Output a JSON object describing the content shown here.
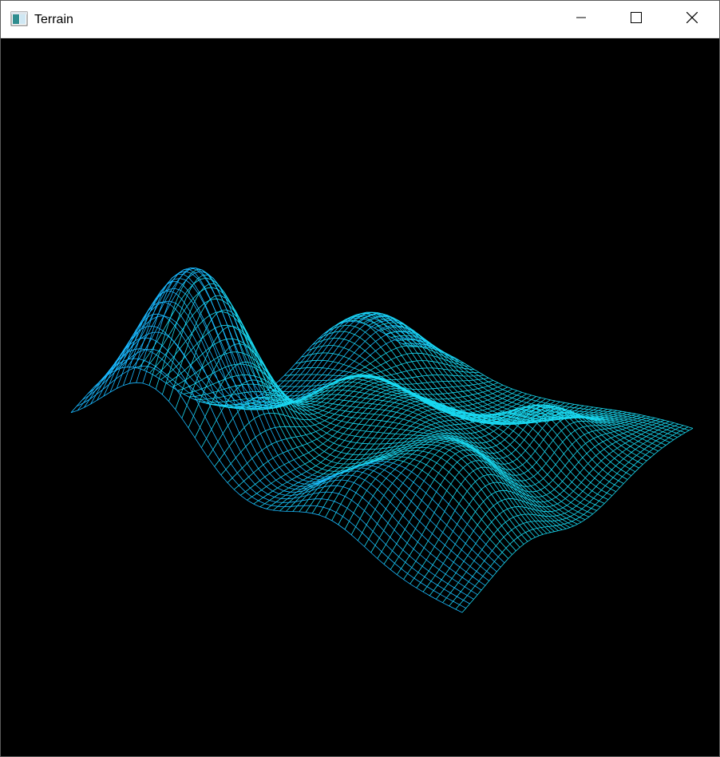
{
  "window": {
    "title": "Terrain",
    "icon": "window-app-icon",
    "controls": [
      {
        "name": "minimize",
        "icon": "minimize-icon"
      },
      {
        "name": "maximize",
        "icon": "maximize-icon"
      },
      {
        "name": "close",
        "icon": "close-icon"
      }
    ]
  },
  "scene": {
    "background": "#000000",
    "render_mode": "wireframe",
    "colors": {
      "near": "#19d8f0",
      "far": "#1ab8ff",
      "peak": "#22f2f0"
    }
  }
}
